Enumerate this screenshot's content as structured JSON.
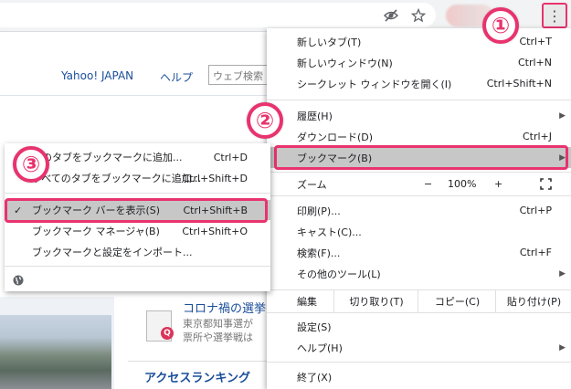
{
  "toolbar": {
    "icons": [
      "eye-slash-icon",
      "star-icon",
      "kebab-menu-icon"
    ],
    "menu_glyph": "⋮"
  },
  "page": {
    "nav": [
      "Yahoo! JAPAN",
      "ヘルプ"
    ],
    "search_placeholder": "ウェブ検索",
    "news_title": "コロナ禍の選挙",
    "news_sub1": "東京都知事選が",
    "news_sub2": "票所や選挙戦は",
    "ranking": "アクセスランキング"
  },
  "main_menu": {
    "new_tab": {
      "label": "新しいタブ(T)",
      "shortcut": "Ctrl+T"
    },
    "new_window": {
      "label": "新しいウィンドウ(N)",
      "shortcut": "Ctrl+N"
    },
    "incognito": {
      "label": "シークレット ウィンドウを開く(I)",
      "shortcut": "Ctrl+Shift+N"
    },
    "history": {
      "label": "履歴(H)"
    },
    "downloads": {
      "label": "ダウンロード(D)",
      "shortcut": "Ctrl+J"
    },
    "bookmarks": {
      "label": "ブックマーク(B)"
    },
    "zoom": {
      "label": "ズーム",
      "minus": "−",
      "value": "100%",
      "plus": "+"
    },
    "print": {
      "label": "印刷(P)...",
      "shortcut": "Ctrl+P"
    },
    "cast": {
      "label": "キャスト(C)..."
    },
    "find": {
      "label": "検索(F)...",
      "shortcut": "Ctrl+F"
    },
    "more_tools": {
      "label": "その他のツール(L)"
    },
    "edit": {
      "label": "編集",
      "cut": "切り取り(T)",
      "copy": "コピー(C)",
      "paste": "貼り付け(P)"
    },
    "settings": {
      "label": "設定(S)"
    },
    "help": {
      "label": "ヘルプ(H)"
    },
    "exit": {
      "label": "終了(X)"
    }
  },
  "sub_menu": {
    "bookmark_tab": {
      "label": "このタブをブックマークに追加...",
      "shortcut": "Ctrl+D"
    },
    "bookmark_all": {
      "label": "すべてのタブをブックマークに追加...",
      "shortcut": "Ctrl+Shift+D"
    },
    "show_bar": {
      "label": "ブックマーク バーを表示(S)",
      "shortcut": "Ctrl+Shift+B",
      "check": "✓"
    },
    "manager": {
      "label": "ブックマーク マネージャ(B)",
      "shortcut": "Ctrl+Shift+O"
    },
    "import": {
      "label": "ブックマークと設定をインポート..."
    }
  },
  "badges": [
    "①",
    "②",
    "③"
  ],
  "colors": {
    "accent": "#e8336e",
    "highlight": "#c7c7c7",
    "link": "#1a4e9a"
  }
}
